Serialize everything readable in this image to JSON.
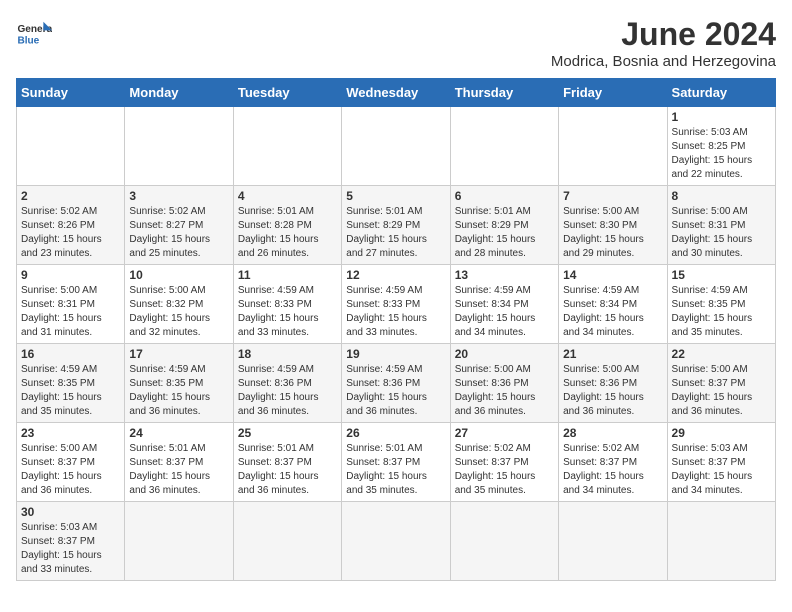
{
  "logo": {
    "text_general": "General",
    "text_blue": "Blue"
  },
  "title": "June 2024",
  "subtitle": "Modrica, Bosnia and Herzegovina",
  "days_of_week": [
    "Sunday",
    "Monday",
    "Tuesday",
    "Wednesday",
    "Thursday",
    "Friday",
    "Saturday"
  ],
  "weeks": [
    [
      {
        "day": "",
        "info": ""
      },
      {
        "day": "",
        "info": ""
      },
      {
        "day": "",
        "info": ""
      },
      {
        "day": "",
        "info": ""
      },
      {
        "day": "",
        "info": ""
      },
      {
        "day": "",
        "info": ""
      },
      {
        "day": "1",
        "info": "Sunrise: 5:03 AM\nSunset: 8:25 PM\nDaylight: 15 hours\nand 22 minutes."
      }
    ],
    [
      {
        "day": "2",
        "info": "Sunrise: 5:02 AM\nSunset: 8:26 PM\nDaylight: 15 hours\nand 23 minutes."
      },
      {
        "day": "3",
        "info": "Sunrise: 5:02 AM\nSunset: 8:27 PM\nDaylight: 15 hours\nand 25 minutes."
      },
      {
        "day": "4",
        "info": "Sunrise: 5:01 AM\nSunset: 8:28 PM\nDaylight: 15 hours\nand 26 minutes."
      },
      {
        "day": "5",
        "info": "Sunrise: 5:01 AM\nSunset: 8:29 PM\nDaylight: 15 hours\nand 27 minutes."
      },
      {
        "day": "6",
        "info": "Sunrise: 5:01 AM\nSunset: 8:29 PM\nDaylight: 15 hours\nand 28 minutes."
      },
      {
        "day": "7",
        "info": "Sunrise: 5:00 AM\nSunset: 8:30 PM\nDaylight: 15 hours\nand 29 minutes."
      },
      {
        "day": "8",
        "info": "Sunrise: 5:00 AM\nSunset: 8:31 PM\nDaylight: 15 hours\nand 30 minutes."
      }
    ],
    [
      {
        "day": "9",
        "info": "Sunrise: 5:00 AM\nSunset: 8:31 PM\nDaylight: 15 hours\nand 31 minutes."
      },
      {
        "day": "10",
        "info": "Sunrise: 5:00 AM\nSunset: 8:32 PM\nDaylight: 15 hours\nand 32 minutes."
      },
      {
        "day": "11",
        "info": "Sunrise: 4:59 AM\nSunset: 8:33 PM\nDaylight: 15 hours\nand 33 minutes."
      },
      {
        "day": "12",
        "info": "Sunrise: 4:59 AM\nSunset: 8:33 PM\nDaylight: 15 hours\nand 33 minutes."
      },
      {
        "day": "13",
        "info": "Sunrise: 4:59 AM\nSunset: 8:34 PM\nDaylight: 15 hours\nand 34 minutes."
      },
      {
        "day": "14",
        "info": "Sunrise: 4:59 AM\nSunset: 8:34 PM\nDaylight: 15 hours\nand 34 minutes."
      },
      {
        "day": "15",
        "info": "Sunrise: 4:59 AM\nSunset: 8:35 PM\nDaylight: 15 hours\nand 35 minutes."
      }
    ],
    [
      {
        "day": "16",
        "info": "Sunrise: 4:59 AM\nSunset: 8:35 PM\nDaylight: 15 hours\nand 35 minutes."
      },
      {
        "day": "17",
        "info": "Sunrise: 4:59 AM\nSunset: 8:35 PM\nDaylight: 15 hours\nand 36 minutes."
      },
      {
        "day": "18",
        "info": "Sunrise: 4:59 AM\nSunset: 8:36 PM\nDaylight: 15 hours\nand 36 minutes."
      },
      {
        "day": "19",
        "info": "Sunrise: 4:59 AM\nSunset: 8:36 PM\nDaylight: 15 hours\nand 36 minutes."
      },
      {
        "day": "20",
        "info": "Sunrise: 5:00 AM\nSunset: 8:36 PM\nDaylight: 15 hours\nand 36 minutes."
      },
      {
        "day": "21",
        "info": "Sunrise: 5:00 AM\nSunset: 8:36 PM\nDaylight: 15 hours\nand 36 minutes."
      },
      {
        "day": "22",
        "info": "Sunrise: 5:00 AM\nSunset: 8:37 PM\nDaylight: 15 hours\nand 36 minutes."
      }
    ],
    [
      {
        "day": "23",
        "info": "Sunrise: 5:00 AM\nSunset: 8:37 PM\nDaylight: 15 hours\nand 36 minutes."
      },
      {
        "day": "24",
        "info": "Sunrise: 5:01 AM\nSunset: 8:37 PM\nDaylight: 15 hours\nand 36 minutes."
      },
      {
        "day": "25",
        "info": "Sunrise: 5:01 AM\nSunset: 8:37 PM\nDaylight: 15 hours\nand 36 minutes."
      },
      {
        "day": "26",
        "info": "Sunrise: 5:01 AM\nSunset: 8:37 PM\nDaylight: 15 hours\nand 35 minutes."
      },
      {
        "day": "27",
        "info": "Sunrise: 5:02 AM\nSunset: 8:37 PM\nDaylight: 15 hours\nand 35 minutes."
      },
      {
        "day": "28",
        "info": "Sunrise: 5:02 AM\nSunset: 8:37 PM\nDaylight: 15 hours\nand 34 minutes."
      },
      {
        "day": "29",
        "info": "Sunrise: 5:03 AM\nSunset: 8:37 PM\nDaylight: 15 hours\nand 34 minutes."
      }
    ],
    [
      {
        "day": "30",
        "info": "Sunrise: 5:03 AM\nSunset: 8:37 PM\nDaylight: 15 hours\nand 33 minutes."
      },
      {
        "day": "",
        "info": ""
      },
      {
        "day": "",
        "info": ""
      },
      {
        "day": "",
        "info": ""
      },
      {
        "day": "",
        "info": ""
      },
      {
        "day": "",
        "info": ""
      },
      {
        "day": "",
        "info": ""
      }
    ]
  ]
}
